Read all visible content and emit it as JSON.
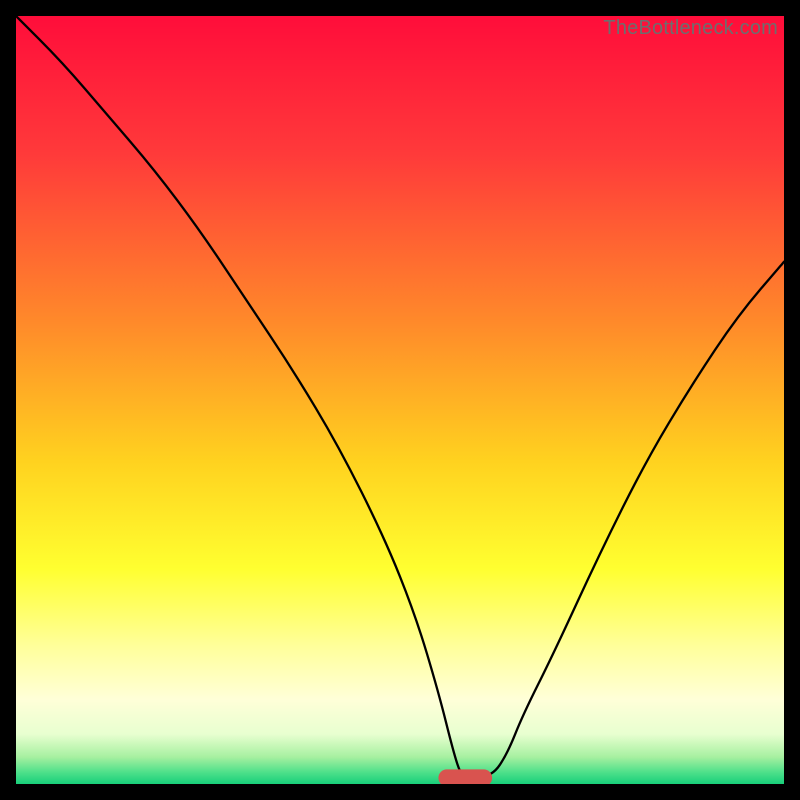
{
  "watermark": "TheBottleneck.com",
  "chart_data": {
    "type": "line",
    "title": "",
    "xlabel": "",
    "ylabel": "",
    "xlim": [
      0,
      100
    ],
    "ylim": [
      0,
      100
    ],
    "series": [
      {
        "name": "bottleneck-curve",
        "x": [
          0,
          6,
          12,
          18,
          24,
          30,
          36,
          42,
          48,
          52,
          55,
          57,
          58,
          59,
          62,
          64,
          66,
          70,
          76,
          82,
          88,
          94,
          100
        ],
        "values": [
          100,
          94,
          87,
          80,
          72,
          63,
          54,
          44,
          32,
          22,
          12,
          4,
          1,
          1,
          1,
          4,
          9,
          17,
          30,
          42,
          52,
          61,
          68
        ]
      }
    ],
    "marker": {
      "name": "optimal-range",
      "x_center": 58.5,
      "y": 0.8,
      "width": 7,
      "height": 2.2,
      "color": "#d9534f"
    },
    "gradient_stops": [
      {
        "offset": 0.0,
        "color": "#ff0d3a"
      },
      {
        "offset": 0.18,
        "color": "#ff3a3a"
      },
      {
        "offset": 0.4,
        "color": "#ff8a2a"
      },
      {
        "offset": 0.58,
        "color": "#ffd21f"
      },
      {
        "offset": 0.72,
        "color": "#ffff30"
      },
      {
        "offset": 0.82,
        "color": "#ffff9a"
      },
      {
        "offset": 0.89,
        "color": "#ffffd8"
      },
      {
        "offset": 0.935,
        "color": "#e8ffd0"
      },
      {
        "offset": 0.965,
        "color": "#a6f0a0"
      },
      {
        "offset": 0.985,
        "color": "#4de08a"
      },
      {
        "offset": 1.0,
        "color": "#18cf7a"
      }
    ]
  }
}
